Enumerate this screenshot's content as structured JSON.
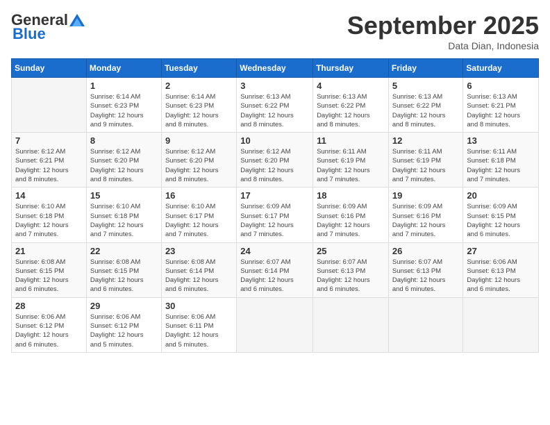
{
  "logo": {
    "general": "General",
    "blue": "Blue"
  },
  "header": {
    "title": "September 2025",
    "subtitle": "Data Dian, Indonesia"
  },
  "weekdays": [
    "Sunday",
    "Monday",
    "Tuesday",
    "Wednesday",
    "Thursday",
    "Friday",
    "Saturday"
  ],
  "weeks": [
    [
      {
        "day": "",
        "info": ""
      },
      {
        "day": "1",
        "info": "Sunrise: 6:14 AM\nSunset: 6:23 PM\nDaylight: 12 hours\nand 9 minutes."
      },
      {
        "day": "2",
        "info": "Sunrise: 6:14 AM\nSunset: 6:23 PM\nDaylight: 12 hours\nand 8 minutes."
      },
      {
        "day": "3",
        "info": "Sunrise: 6:13 AM\nSunset: 6:22 PM\nDaylight: 12 hours\nand 8 minutes."
      },
      {
        "day": "4",
        "info": "Sunrise: 6:13 AM\nSunset: 6:22 PM\nDaylight: 12 hours\nand 8 minutes."
      },
      {
        "day": "5",
        "info": "Sunrise: 6:13 AM\nSunset: 6:22 PM\nDaylight: 12 hours\nand 8 minutes."
      },
      {
        "day": "6",
        "info": "Sunrise: 6:13 AM\nSunset: 6:21 PM\nDaylight: 12 hours\nand 8 minutes."
      }
    ],
    [
      {
        "day": "7",
        "info": "Sunrise: 6:12 AM\nSunset: 6:21 PM\nDaylight: 12 hours\nand 8 minutes."
      },
      {
        "day": "8",
        "info": "Sunrise: 6:12 AM\nSunset: 6:20 PM\nDaylight: 12 hours\nand 8 minutes."
      },
      {
        "day": "9",
        "info": "Sunrise: 6:12 AM\nSunset: 6:20 PM\nDaylight: 12 hours\nand 8 minutes."
      },
      {
        "day": "10",
        "info": "Sunrise: 6:12 AM\nSunset: 6:20 PM\nDaylight: 12 hours\nand 8 minutes."
      },
      {
        "day": "11",
        "info": "Sunrise: 6:11 AM\nSunset: 6:19 PM\nDaylight: 12 hours\nand 7 minutes."
      },
      {
        "day": "12",
        "info": "Sunrise: 6:11 AM\nSunset: 6:19 PM\nDaylight: 12 hours\nand 7 minutes."
      },
      {
        "day": "13",
        "info": "Sunrise: 6:11 AM\nSunset: 6:18 PM\nDaylight: 12 hours\nand 7 minutes."
      }
    ],
    [
      {
        "day": "14",
        "info": "Sunrise: 6:10 AM\nSunset: 6:18 PM\nDaylight: 12 hours\nand 7 minutes."
      },
      {
        "day": "15",
        "info": "Sunrise: 6:10 AM\nSunset: 6:18 PM\nDaylight: 12 hours\nand 7 minutes."
      },
      {
        "day": "16",
        "info": "Sunrise: 6:10 AM\nSunset: 6:17 PM\nDaylight: 12 hours\nand 7 minutes."
      },
      {
        "day": "17",
        "info": "Sunrise: 6:09 AM\nSunset: 6:17 PM\nDaylight: 12 hours\nand 7 minutes."
      },
      {
        "day": "18",
        "info": "Sunrise: 6:09 AM\nSunset: 6:16 PM\nDaylight: 12 hours\nand 7 minutes."
      },
      {
        "day": "19",
        "info": "Sunrise: 6:09 AM\nSunset: 6:16 PM\nDaylight: 12 hours\nand 7 minutes."
      },
      {
        "day": "20",
        "info": "Sunrise: 6:09 AM\nSunset: 6:15 PM\nDaylight: 12 hours\nand 6 minutes."
      }
    ],
    [
      {
        "day": "21",
        "info": "Sunrise: 6:08 AM\nSunset: 6:15 PM\nDaylight: 12 hours\nand 6 minutes."
      },
      {
        "day": "22",
        "info": "Sunrise: 6:08 AM\nSunset: 6:15 PM\nDaylight: 12 hours\nand 6 minutes."
      },
      {
        "day": "23",
        "info": "Sunrise: 6:08 AM\nSunset: 6:14 PM\nDaylight: 12 hours\nand 6 minutes."
      },
      {
        "day": "24",
        "info": "Sunrise: 6:07 AM\nSunset: 6:14 PM\nDaylight: 12 hours\nand 6 minutes."
      },
      {
        "day": "25",
        "info": "Sunrise: 6:07 AM\nSunset: 6:13 PM\nDaylight: 12 hours\nand 6 minutes."
      },
      {
        "day": "26",
        "info": "Sunrise: 6:07 AM\nSunset: 6:13 PM\nDaylight: 12 hours\nand 6 minutes."
      },
      {
        "day": "27",
        "info": "Sunrise: 6:06 AM\nSunset: 6:13 PM\nDaylight: 12 hours\nand 6 minutes."
      }
    ],
    [
      {
        "day": "28",
        "info": "Sunrise: 6:06 AM\nSunset: 6:12 PM\nDaylight: 12 hours\nand 6 minutes."
      },
      {
        "day": "29",
        "info": "Sunrise: 6:06 AM\nSunset: 6:12 PM\nDaylight: 12 hours\nand 5 minutes."
      },
      {
        "day": "30",
        "info": "Sunrise: 6:06 AM\nSunset: 6:11 PM\nDaylight: 12 hours\nand 5 minutes."
      },
      {
        "day": "",
        "info": ""
      },
      {
        "day": "",
        "info": ""
      },
      {
        "day": "",
        "info": ""
      },
      {
        "day": "",
        "info": ""
      }
    ]
  ]
}
